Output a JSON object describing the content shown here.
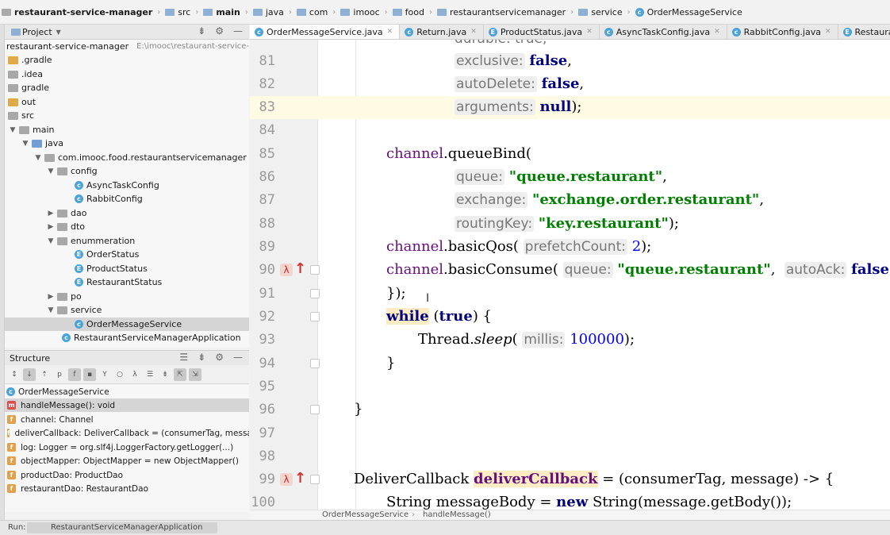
{
  "breadcrumb": [
    "restaurant-service-manager",
    "src",
    "main",
    "java",
    "com",
    "imooc",
    "food",
    "restaurantservicemanager",
    "service",
    "OrderMessageService"
  ],
  "project": {
    "title": "Project",
    "root_name": "restaurant-service-manager",
    "root_path": "E:\\imooc\\restaurant-service-mana",
    "items": [
      ".gradle",
      ".idea",
      "gradle",
      "out",
      "src",
      "main",
      "java",
      "com.imooc.food.restaurantservicemanager",
      "config",
      "AsyncTaskConfig",
      "RabbitConfig",
      "dao",
      "dto",
      "enummeration",
      "OrderStatus",
      "ProductStatus",
      "RestaurantStatus",
      "po",
      "service",
      "OrderMessageService",
      "RestaurantServiceManagerApplication"
    ]
  },
  "structure": {
    "title": "Structure",
    "items": [
      "OrderMessageService",
      "handleMessage(): void",
      "channel: Channel",
      "deliverCallback: DeliverCallback = (consumerTag, messag",
      "log: Logger = org.slf4j.LoggerFactory.getLogger(...)",
      "objectMapper: ObjectMapper = new ObjectMapper()",
      "productDao: ProductDao",
      "restaurantDao: RestaurantDao"
    ]
  },
  "tabs": [
    "OrderMessageService.java",
    "Return.java",
    "ProductStatus.java",
    "AsyncTaskConfig.java",
    "RabbitConfig.java",
    "RestaurantStatus.java"
  ],
  "editor": {
    "line_numbers": [
      "81",
      "82",
      "83",
      "84",
      "85",
      "86",
      "87",
      "88",
      "89",
      "90",
      "91",
      "92",
      "93",
      "94",
      "95",
      "96",
      "97",
      "98",
      "99",
      "100"
    ],
    "top_partial": "durable: true,",
    "bottom_breadcrumb": [
      "OrderMessageService",
      "handleMessage()"
    ]
  },
  "code": {
    "l81_hint": "exclusive:",
    "l81_val": "false",
    "l82_hint": "autoDelete:",
    "l82_val": "false",
    "l83_hint": "arguments:",
    "l83_val": "null",
    "l85_obj": "channel",
    "l85_m": "queueBind(",
    "l86_hint": "queue:",
    "l86_str": "\"queue.restaurant\"",
    "l87_hint": "exchange:",
    "l87_str": "\"exchange.order.restaurant\"",
    "l88_hint": "routingKey:",
    "l88_str": "\"key.restaurant\"",
    "l89_obj": "channel",
    "l89_m": "basicQos(",
    "l89_hint": "prefetchCount:",
    "l89_num": "2",
    "l90_obj": "channel",
    "l90_m": "basicConsume(",
    "l90_hint1": "queue:",
    "l90_str": "\"queue.restaurant\"",
    "l90_hint2": "autoAck:",
    "l90_val": "false",
    "l91": "});",
    "l92_kw": "while",
    "l92_val": "true",
    "l93_cls": "Thread.",
    "l93_m": "sleep",
    "l93_hint": "millis:",
    "l93_num": "100000",
    "l94": "}",
    "l96": "}",
    "l99_type": "DeliverCallback",
    "l99_var": "deliverCallback",
    "l99_rest": "= (consumerTag, message) -> {",
    "l100_a": "String messageBody =",
    "l100_kw": "new",
    "l100_b": "String(message.getBody());"
  },
  "status_bottom": {
    "run_label": "Run:",
    "run_config": "RestaurantServiceManagerApplication"
  }
}
